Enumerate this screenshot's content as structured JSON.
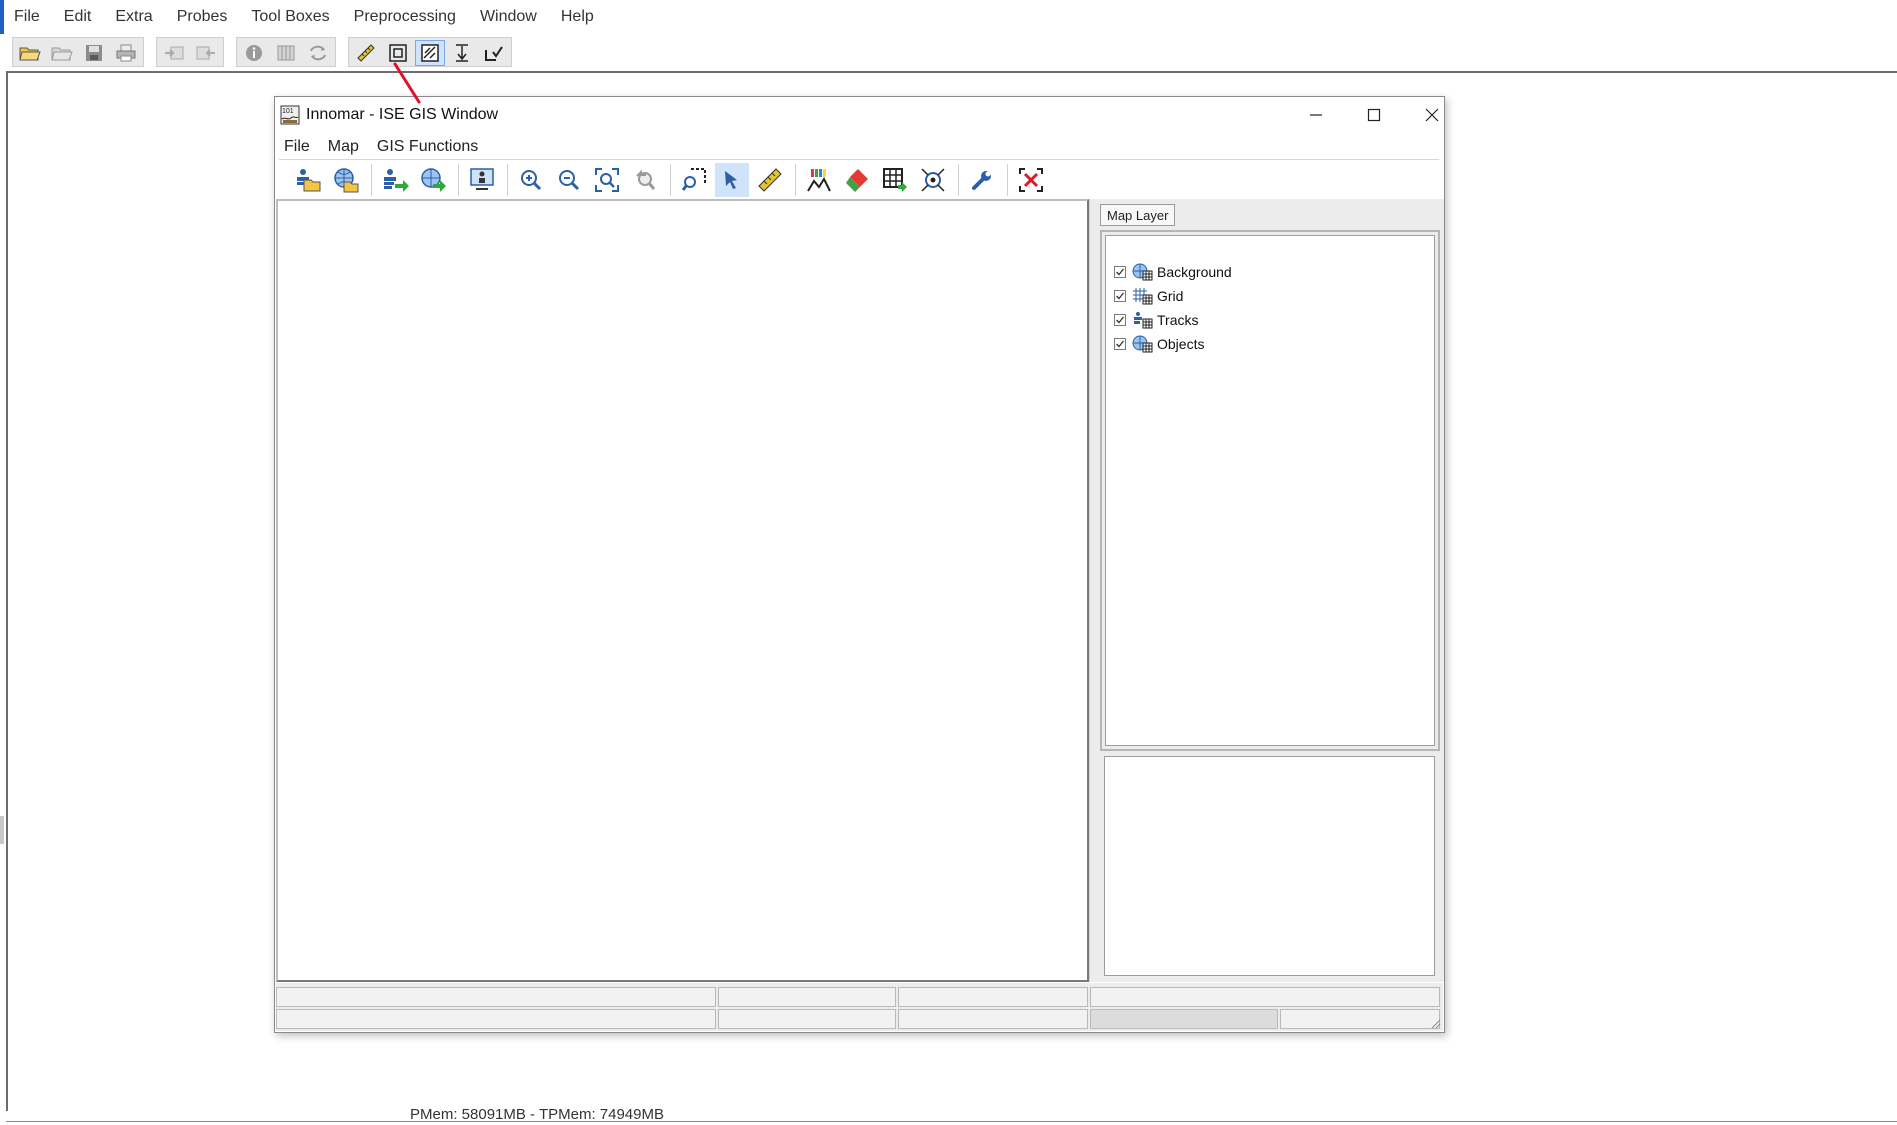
{
  "main_menu": [
    "File",
    "Edit",
    "Extra",
    "Probes",
    "Tool Boxes",
    "Preprocessing",
    "Window",
    "Help"
  ],
  "main_toolbar": {
    "groups": [
      [
        "open-folder-icon",
        "open-folder-disabled-icon",
        "save-icon",
        "print-icon"
      ],
      [
        "export-disabled-icon",
        "import-disabled-icon"
      ],
      [
        "info-icon",
        "columns-icon",
        "refresh-icon"
      ],
      [
        "ruler-icon",
        "frame-icon",
        "gis-window-icon",
        "depth-marker-icon",
        "bottom-check-icon"
      ]
    ],
    "active": "gis-window-icon"
  },
  "gis_window": {
    "title": "Innomar - ISE GIS Window",
    "controls": [
      "minimize-icon",
      "maximize-icon",
      "close-icon"
    ],
    "menu": [
      "File",
      "Map",
      "GIS Functions"
    ],
    "toolbar_active": "select-arrow-icon",
    "side_panel": {
      "tab": "Map Layer",
      "layers": [
        {
          "label": "Background",
          "checked": true,
          "icon": "globe-layer-icon"
        },
        {
          "label": "Grid",
          "checked": true,
          "icon": "grid-layer-icon"
        },
        {
          "label": "Tracks",
          "checked": true,
          "icon": "track-layer-icon"
        },
        {
          "label": "Objects",
          "checked": true,
          "icon": "objects-layer-icon"
        }
      ]
    }
  },
  "footer": {
    "memory": "PMem: 58091MB - TPMem: 74949MB"
  },
  "colors": {
    "accent": "#1f5fbf",
    "active_button": "#cfe3fb",
    "annotation_arrow": "#e0102a"
  }
}
